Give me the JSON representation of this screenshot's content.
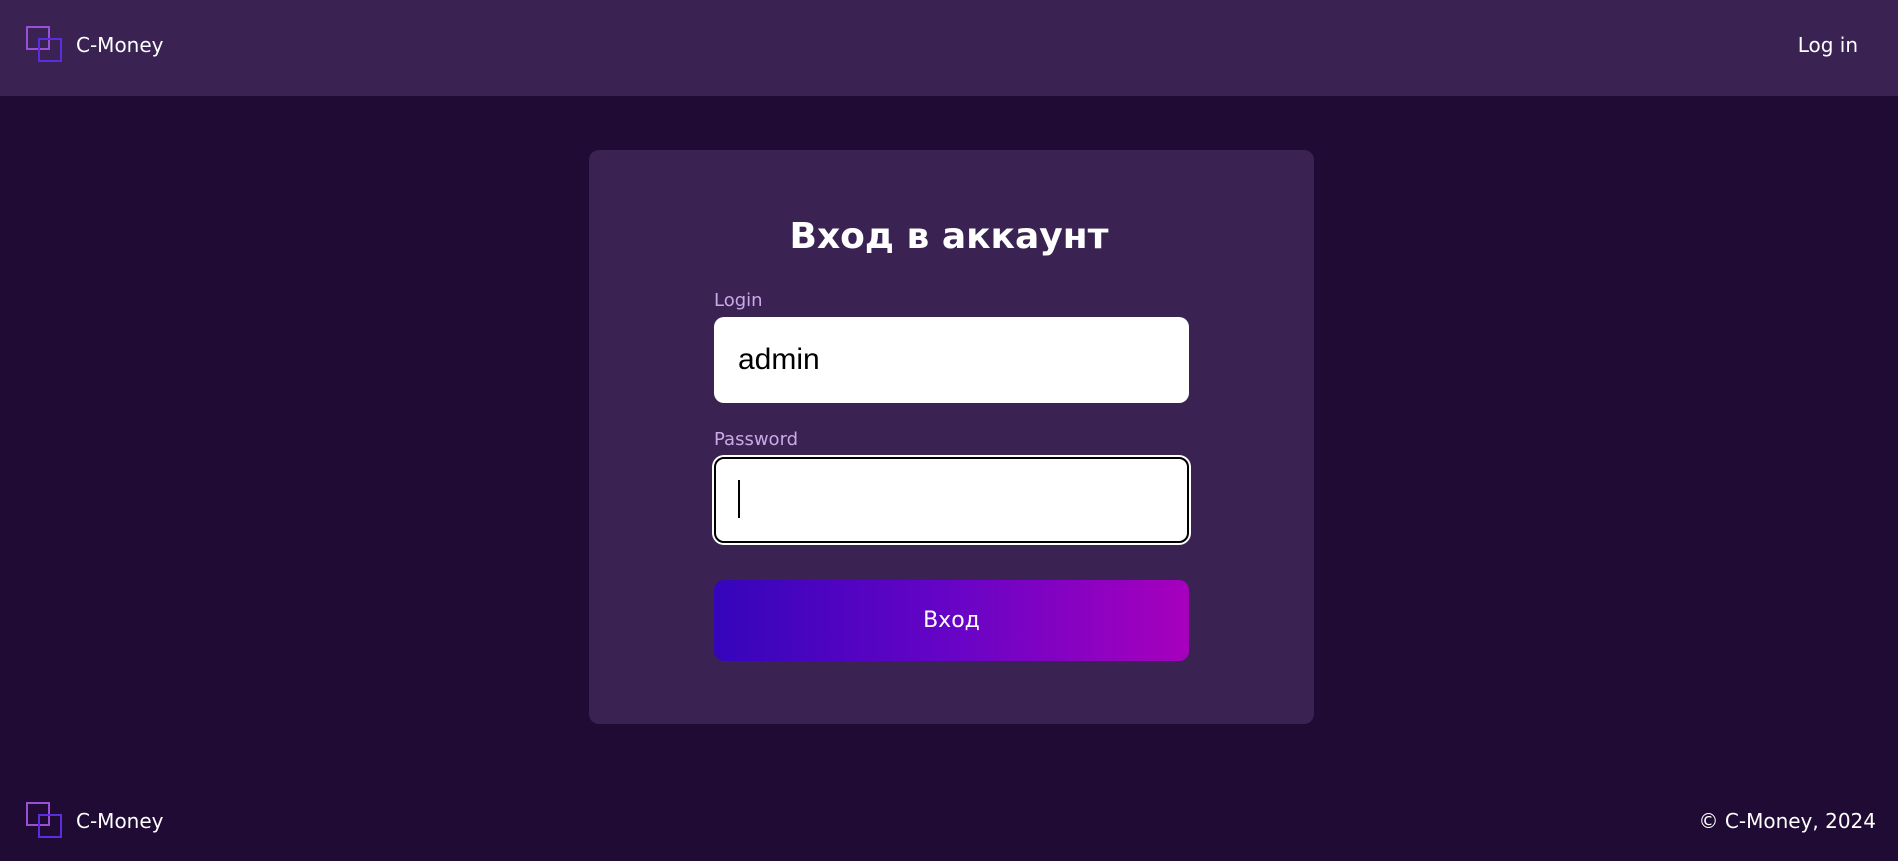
{
  "header": {
    "brand_name": "C-Money",
    "login_link": "Log in"
  },
  "login_form": {
    "title": "Вход в аккаунт",
    "login_label": "Login",
    "login_value": "admin",
    "password_label": "Password",
    "password_value": "",
    "submit_label": "Вход"
  },
  "footer": {
    "brand_name": "C-Money",
    "copyright": "© C-Money, 2024"
  },
  "colors": {
    "page_background": "#200b34",
    "panel_background": "#3a2353",
    "label_color": "#c9a9e6",
    "button_gradient_start": "#3505bb",
    "button_gradient_end": "#a700bd"
  },
  "icons": {
    "logo": "overlapping-squares-logo"
  }
}
